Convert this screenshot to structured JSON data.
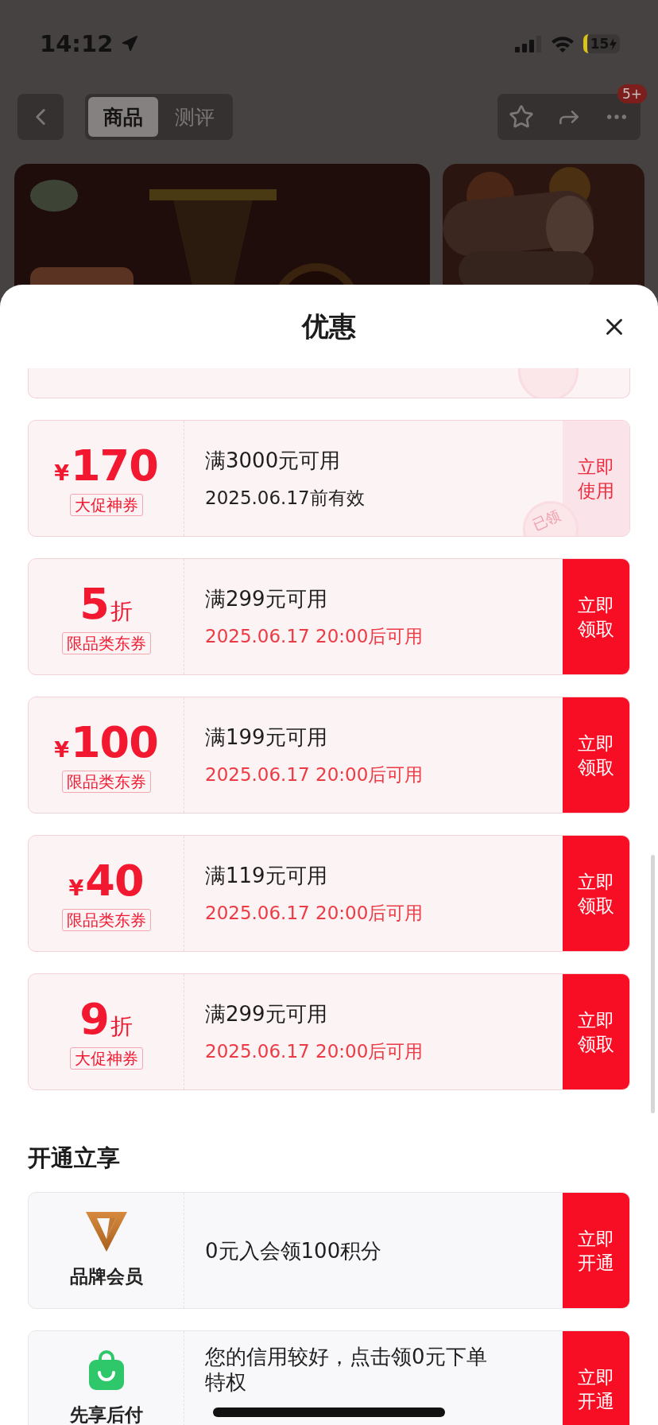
{
  "status_bar": {
    "time": "14:12",
    "battery": "15"
  },
  "nav": {
    "tabs": [
      {
        "label": "商品",
        "selected": true
      },
      {
        "label": "测评",
        "selected": false
      }
    ],
    "badge": "5+"
  },
  "sheet": {
    "title": "优惠",
    "partial_coupon": {
      "claimed": true
    },
    "coupons": [
      {
        "kind": "amount",
        "symbol": "¥",
        "value": "170",
        "tag": "大促神券",
        "condition": "满3000元可用",
        "validity": "2025.06.17前有效",
        "upcoming": false,
        "claimed": true,
        "stamp": "已领",
        "button": "立即使用"
      },
      {
        "kind": "discount",
        "value": "5",
        "unit": "折",
        "tag": "限品类东券",
        "condition": "满299元可用",
        "validity": "2025.06.17 20:00后可用",
        "upcoming": true,
        "claimed": false,
        "button": "立即领取"
      },
      {
        "kind": "amount",
        "symbol": "¥",
        "value": "100",
        "tag": "限品类东券",
        "condition": "满199元可用",
        "validity": "2025.06.17 20:00后可用",
        "upcoming": true,
        "claimed": false,
        "button": "立即领取"
      },
      {
        "kind": "amount",
        "symbol": "¥",
        "value": "40",
        "tag": "限品类东券",
        "condition": "满119元可用",
        "validity": "2025.06.17 20:00后可用",
        "upcoming": true,
        "claimed": false,
        "button": "立即领取"
      },
      {
        "kind": "discount",
        "value": "9",
        "unit": "折",
        "tag": "大促神券",
        "condition": "满299元可用",
        "validity": "2025.06.17 20:00后可用",
        "upcoming": true,
        "claimed": false,
        "button": "立即领取"
      }
    ],
    "section_title": "开通立享",
    "offers": [
      {
        "kind": "brand",
        "label": "品牌会员",
        "text": "0元入会领100积分",
        "button": "立即开通"
      },
      {
        "kind": "pay",
        "label": "先享后付",
        "text": "您的信用较好，点击领0元下单特权",
        "button": "立即开通"
      }
    ]
  }
}
